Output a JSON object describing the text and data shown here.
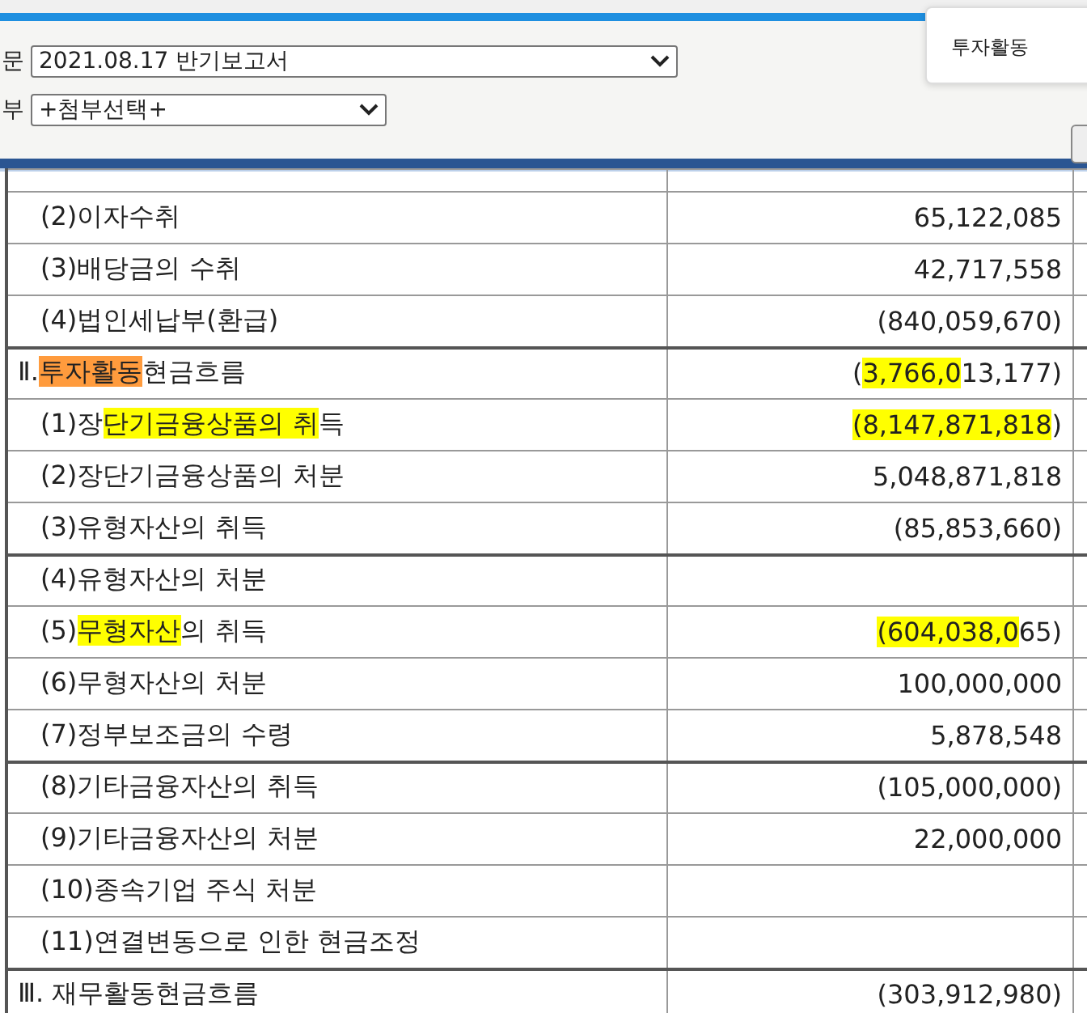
{
  "toolbar": {
    "report_label": "문",
    "report_select": "2021.08.17  반기보고서",
    "attach_label": "부",
    "attach_select": "+첨부선택+"
  },
  "search_popup": {
    "text": "투자활동"
  },
  "table": {
    "rows": [
      {
        "group_start": false,
        "label": [
          {
            "text": "(2)이자수취"
          }
        ],
        "value": [
          {
            "text": "65,122,085"
          }
        ]
      },
      {
        "group_start": false,
        "label": [
          {
            "text": "(3)배당금의 수취"
          }
        ],
        "value": [
          {
            "text": "42,717,558"
          }
        ]
      },
      {
        "group_start": false,
        "label": [
          {
            "text": "(4)법인세납부(환급)"
          }
        ],
        "value": [
          {
            "text": "(840,059,670)"
          }
        ]
      },
      {
        "group_start": true,
        "label": [
          {
            "text": "Ⅱ."
          },
          {
            "text": "투자활동",
            "color": "#ff9b3d"
          },
          {
            "text": "현금흐름"
          }
        ],
        "value": [
          {
            "text": "("
          },
          {
            "text": "3,766,0",
            "color": "#ffff00"
          },
          {
            "text": "13,177)"
          }
        ]
      },
      {
        "group_start": false,
        "label": [
          {
            "text": "(1)장"
          },
          {
            "text": "단기금융상품의 취",
            "color": "#ffff00"
          },
          {
            "text": "득"
          }
        ],
        "value": [
          {
            "text": "(8,147,871,818",
            "color": "#ffff00"
          },
          {
            "text": ")"
          }
        ]
      },
      {
        "group_start": false,
        "label": [
          {
            "text": "(2)장단기금융상품의 처분"
          }
        ],
        "value": [
          {
            "text": "5,048,871,818"
          }
        ]
      },
      {
        "group_start": false,
        "label": [
          {
            "text": "(3)유형자산의 취득"
          }
        ],
        "value": [
          {
            "text": "(85,853,660)"
          }
        ]
      },
      {
        "group_start": true,
        "label": [
          {
            "text": "(4)유형자산의 처분"
          }
        ],
        "value": []
      },
      {
        "group_start": false,
        "label": [
          {
            "text": "(5)"
          },
          {
            "text": "무형자산",
            "color": "#ffff00"
          },
          {
            "text": "의 취득"
          }
        ],
        "value": [
          {
            "text": "(604,038,0",
            "color": "#ffff00"
          },
          {
            "text": "65)"
          }
        ]
      },
      {
        "group_start": false,
        "label": [
          {
            "text": "(6)무형자산의 처분"
          }
        ],
        "value": [
          {
            "text": "100,000,000"
          }
        ]
      },
      {
        "group_start": false,
        "label": [
          {
            "text": "(7)정부보조금의 수령"
          }
        ],
        "value": [
          {
            "text": "5,878,548"
          }
        ]
      },
      {
        "group_start": true,
        "label": [
          {
            "text": "(8)기타금융자산의 취득"
          }
        ],
        "value": [
          {
            "text": "(105,000,000)"
          }
        ]
      },
      {
        "group_start": false,
        "label": [
          {
            "text": "(9)기타금융자산의 처분"
          }
        ],
        "value": [
          {
            "text": "22,000,000"
          }
        ]
      },
      {
        "group_start": false,
        "label": [
          {
            "text": "(10)종속기업 주식 처분"
          }
        ],
        "value": []
      },
      {
        "group_start": false,
        "label": [
          {
            "text": "(11)연결변동으로 인한 현금조정"
          }
        ],
        "value": []
      },
      {
        "group_start": true,
        "label": [
          {
            "text": "Ⅲ. 재무활동현금흐름"
          }
        ],
        "value": [
          {
            "text": "(303,912,980)"
          }
        ]
      }
    ]
  }
}
